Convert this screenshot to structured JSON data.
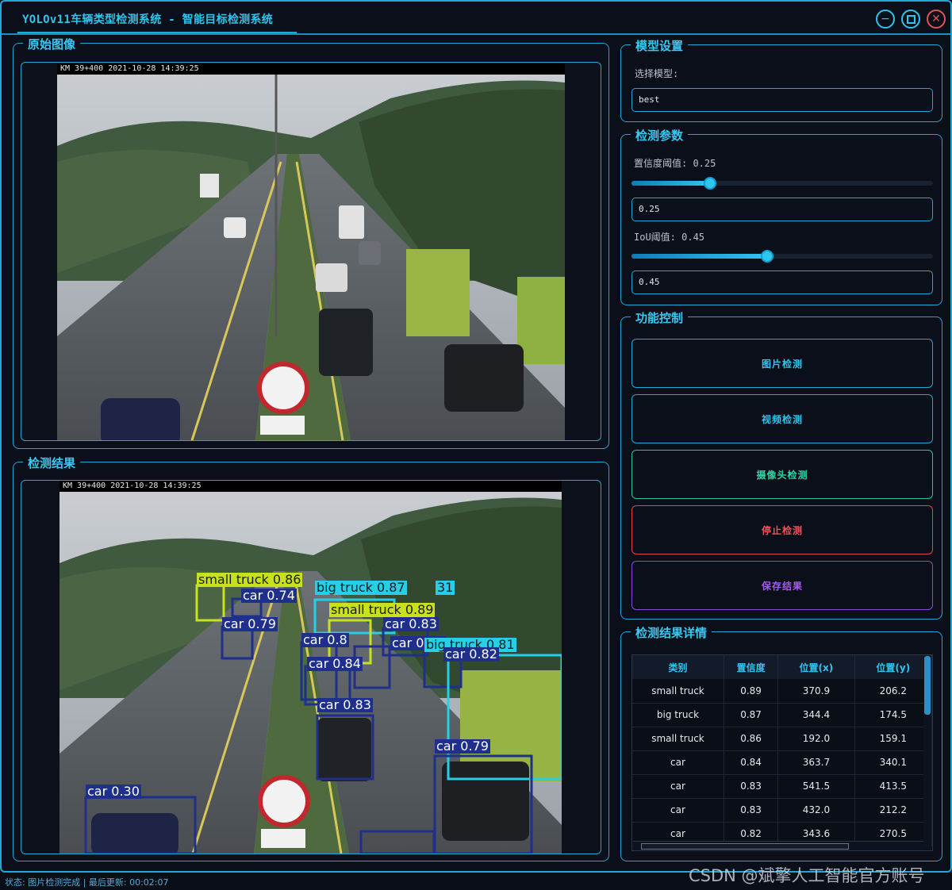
{
  "window": {
    "title": "YOLOv11车辆类型检测系统 - 智能目标检测系统"
  },
  "original_panel": {
    "title": "原始图像",
    "timestamp": "KM 39+400 2021-10-28 14:39:25"
  },
  "result_panel": {
    "title": "检测结果",
    "timestamp": "KM 39+400 2021-10-28 14:39:25",
    "detections": [
      {
        "label": "small truck 0.86",
        "color": "#c8e11e"
      },
      {
        "label": "car 0.74",
        "color": "#1e2f8c"
      },
      {
        "label": "big truck 0.87",
        "color": "#26cfe6"
      },
      {
        "label": "31",
        "color": "#26cfe6"
      },
      {
        "label": "small truck 0.89",
        "color": "#c8e11e"
      },
      {
        "label": "car 0.79",
        "color": "#1e2f8c"
      },
      {
        "label": "car 0.83",
        "color": "#1e2f8c"
      },
      {
        "label": "car 0.8",
        "color": "#1e2f8c"
      },
      {
        "label": "car 0.81",
        "color": "#1e2f8c"
      },
      {
        "label": "big truck 0.81",
        "color": "#26cfe6"
      },
      {
        "label": "car 0.82",
        "color": "#1e2f8c"
      },
      {
        "label": "car 0.84",
        "color": "#1e2f8c"
      },
      {
        "label": "car 0.83",
        "color": "#1e2f8c"
      },
      {
        "label": "car 0.79",
        "color": "#1e2f8c"
      },
      {
        "label": "car 0.30",
        "color": "#1e2f8c"
      }
    ]
  },
  "model_settings": {
    "title": "模型设置",
    "select_label": "选择模型:",
    "model_value": "best"
  },
  "detect_params": {
    "title": "检测参数",
    "conf_label": "置信度阈值: 0.25",
    "conf_value": "0.25",
    "conf_fraction": 0.26,
    "iou_label": "IoU阈值: 0.45",
    "iou_value": "0.45",
    "iou_fraction": 0.45
  },
  "controls": {
    "title": "功能控制",
    "image_detect": "图片检测",
    "video_detect": "视频检测",
    "camera_detect": "摄像头检测",
    "stop_detect": "停止检测",
    "save_result": "保存结果",
    "colors": {
      "image": "#2ec5ef",
      "video": "#2ec5ef",
      "camera": "#2bd6a5",
      "stop": "#f0525a",
      "save": "#a45bf0"
    }
  },
  "details": {
    "title": "检测结果详情",
    "columns": [
      "类别",
      "置信度",
      "位置(x)",
      "位置(y)"
    ],
    "rows": [
      [
        "small truck",
        "0.89",
        "370.9",
        "206.2"
      ],
      [
        "big truck",
        "0.87",
        "344.4",
        "174.5"
      ],
      [
        "small truck",
        "0.86",
        "192.0",
        "159.1"
      ],
      [
        "car",
        "0.84",
        "363.7",
        "340.1"
      ],
      [
        "car",
        "0.83",
        "541.5",
        "413.5"
      ],
      [
        "car",
        "0.83",
        "432.0",
        "212.2"
      ],
      [
        "car",
        "0.82",
        "343.6",
        "270.5"
      ]
    ]
  },
  "status": {
    "text": "状态: 图片检测完成 | 最后更新: 00:02:07"
  },
  "watermark": "CSDN @斌擎人工智能官方账号"
}
